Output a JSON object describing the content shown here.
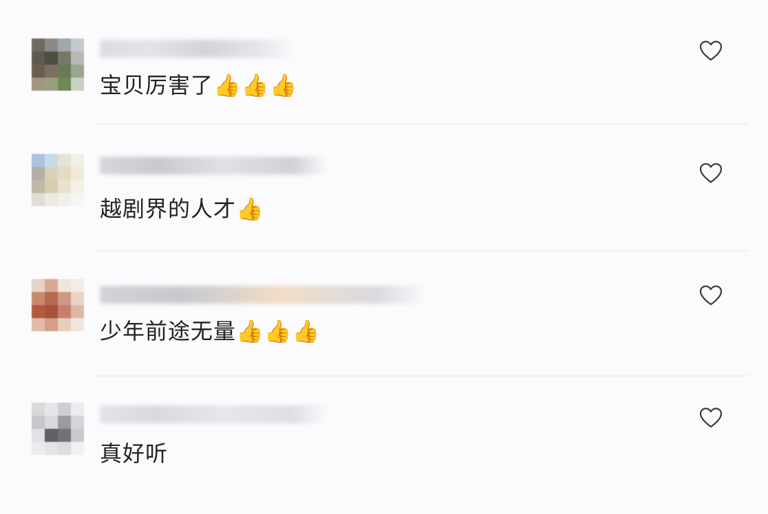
{
  "comments": [
    {
      "text": "宝贝厉害了👍👍👍",
      "like_icon": "heart-outline-icon",
      "avatar": [
        "#6e6a65",
        "#8d8a86",
        "#9ea7ad",
        "#c5c9cc",
        "#5d5a4f",
        "#4e4d3e",
        "#78786a",
        "#b8b9b4",
        "#6b5d50",
        "#7d6f62",
        "#6a7a58",
        "#9aa58c",
        "#a49482",
        "#96a081",
        "#6f8a55",
        "#c9d0be"
      ],
      "username_mask": [
        "#dcdde2",
        "#e3e4e8",
        "#d3d4da",
        "#e8e9ec"
      ]
    },
    {
      "text": "越剧界的人才👍",
      "like_icon": "heart-outline-icon",
      "avatar": [
        "#aac3de",
        "#c9d9e8",
        "#e6e2d6",
        "#f1efe8",
        "#b3b1a7",
        "#d9d2b8",
        "#e5dcc0",
        "#efe9d6",
        "#c2b8a6",
        "#d8ccb0",
        "#e9e2d0",
        "#f3f0e6",
        "#e0dcd6",
        "#ede9e3",
        "#f2f0ec",
        "#f7f6f3"
      ],
      "username_mask": [
        "#d6d7dc",
        "#c9cad0",
        "#e0e1e5",
        "#d0d1d6"
      ]
    },
    {
      "text": "少年前途无量👍👍👍",
      "like_icon": "heart-outline-icon",
      "avatar": [
        "#e7d2c6",
        "#d9a98f",
        "#f1e4da",
        "#f3ece6",
        "#c98a6c",
        "#b76b4e",
        "#cf9a82",
        "#e9d3c4",
        "#b55a3f",
        "#a7513a",
        "#c7806a",
        "#ddb7a5",
        "#e0bca8",
        "#d39f86",
        "#e8cdbd",
        "#f1e6de"
      ],
      "username_mask": [
        "#d2d3d9",
        "#c8c9cf",
        "#f1dcc6",
        "#d9dadf"
      ]
    },
    {
      "text": "真好听",
      "like_icon": "heart-outline-icon",
      "avatar": [
        "#d9d9dc",
        "#e6e6e8",
        "#cfcfd3",
        "#ececef",
        "#c7c7cb",
        "#dadadd",
        "#9b9ca1",
        "#d4d4d8",
        "#e2e2e5",
        "#5f6068",
        "#717279",
        "#c9c9cd",
        "#ebebed",
        "#e4e4e7",
        "#dcdce0",
        "#f1f1f3"
      ],
      "username_mask": [
        "#e2e3e7",
        "#d9dadf",
        "#e6e7ea",
        "#dedfe3"
      ]
    }
  ]
}
